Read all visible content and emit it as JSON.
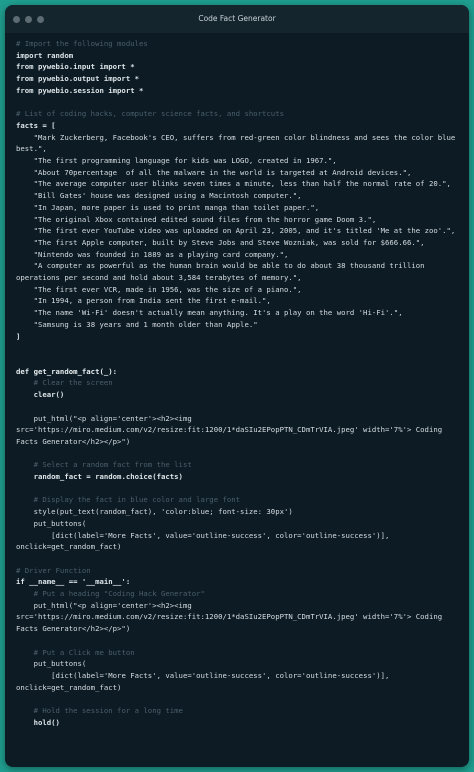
{
  "window": {
    "title": "Code Fact Generator"
  },
  "code": {
    "lines": [
      {
        "cls": "cm",
        "text": "# Import the following modules"
      },
      {
        "cls": "kw",
        "text": "import random"
      },
      {
        "cls": "kw",
        "text": "from pywebio.input import *"
      },
      {
        "cls": "kw",
        "text": "from pywebio.output import *"
      },
      {
        "cls": "kw",
        "text": "from pywebio.session import *"
      },
      {
        "cls": "",
        "text": " "
      },
      {
        "cls": "cm",
        "text": "# List of coding hacks, computer science facts, and shortcuts"
      },
      {
        "cls": "kw",
        "text": "facts = ["
      },
      {
        "cls": "st",
        "text": "    \"Mark Zuckerberg, Facebook's CEO, suffers from red-green color blindness and sees the color blue best.\","
      },
      {
        "cls": "st",
        "text": "    \"The first programming language for kids was LOGO, created in 1967.\","
      },
      {
        "cls": "st",
        "text": "    \"About 70percentage  of all the malware in the world is targeted at Android devices.\","
      },
      {
        "cls": "st",
        "text": "    \"The average computer user blinks seven times a minute, less than half the normal rate of 20.\","
      },
      {
        "cls": "st",
        "text": "    \"Bill Gates' house was designed using a Macintosh computer.\","
      },
      {
        "cls": "st",
        "text": "    \"In Japan, more paper is used to print manga than toilet paper.\","
      },
      {
        "cls": "st",
        "text": "    \"The original Xbox contained edited sound files from the horror game Doom 3.\","
      },
      {
        "cls": "st",
        "text": "    \"The first ever YouTube video was uploaded on April 23, 2005, and it's titled 'Me at the zoo'.\","
      },
      {
        "cls": "st",
        "text": "    \"The first Apple computer, built by Steve Jobs and Steve Wozniak, was sold for $666.66.\","
      },
      {
        "cls": "st",
        "text": "    \"Nintendo was founded in 1889 as a playing card company.\","
      },
      {
        "cls": "st",
        "text": "    \"A computer as powerful as the human brain would be able to do about 38 thousand trillion operations per second and hold about 3,584 terabytes of memory.\","
      },
      {
        "cls": "st",
        "text": "    \"The first ever VCR, made in 1956, was the size of a piano.\","
      },
      {
        "cls": "st",
        "text": "    \"In 1994, a person from India sent the first e-mail.\","
      },
      {
        "cls": "st",
        "text": "    \"The name 'Wi-Fi' doesn't actually mean anything. It's a play on the word 'Hi-Fi'.\","
      },
      {
        "cls": "st",
        "text": "    \"Samsung is 38 years and 1 month older than Apple.\""
      },
      {
        "cls": "kw",
        "text": "]"
      },
      {
        "cls": "",
        "text": " "
      },
      {
        "cls": "",
        "text": " "
      },
      {
        "cls": "fn",
        "text": "def get_random_fact(_):"
      },
      {
        "cls": "cm",
        "text": "    # Clear the screen"
      },
      {
        "cls": "kw",
        "text": "    clear()"
      },
      {
        "cls": "",
        "text": " "
      },
      {
        "cls": "st",
        "text": "    put_html(\"<p align='center'><h2><img src='https://miro.medium.com/v2/resize:fit:1200/1*daSIu2EPopPTN_CDmTrVIA.jpeg' width='7%'> Coding Facts Generator</h2></p>\")"
      },
      {
        "cls": "",
        "text": " "
      },
      {
        "cls": "cm",
        "text": "    # Select a random fact from the list"
      },
      {
        "cls": "kw",
        "text": "    random_fact = random.choice(facts)"
      },
      {
        "cls": "",
        "text": " "
      },
      {
        "cls": "cm",
        "text": "    # Display the fact in blue color and large font"
      },
      {
        "cls": "st",
        "text": "    style(put_text(random_fact), 'color:blue; font-size: 30px')"
      },
      {
        "cls": "st",
        "text": "    put_buttons("
      },
      {
        "cls": "st",
        "text": "        [dict(label='More Facts', value='outline-success', color='outline-success')], onclick=get_random_fact)"
      },
      {
        "cls": "",
        "text": " "
      },
      {
        "cls": "cm",
        "text": "# Driver Function"
      },
      {
        "cls": "kw",
        "text": "if __name__ == '__main__':"
      },
      {
        "cls": "cm",
        "text": "    # Put a heading \"Coding Hack Generator\""
      },
      {
        "cls": "st",
        "text": "    put_html(\"<p align='center'><h2><img src='https://miro.medium.com/v2/resize:fit:1200/1*daSIu2EPopPTN_CDmTrVIA.jpeg' width='7%'> Coding Facts Generator</h2></p>\")"
      },
      {
        "cls": "",
        "text": " "
      },
      {
        "cls": "cm",
        "text": "    # Put a Click me button"
      },
      {
        "cls": "st",
        "text": "    put_buttons("
      },
      {
        "cls": "st",
        "text": "        [dict(label='More Facts', value='outline-success', color='outline-success')], onclick=get_random_fact)"
      },
      {
        "cls": "",
        "text": " "
      },
      {
        "cls": "cm",
        "text": "    # Hold the session for a long time"
      },
      {
        "cls": "kw",
        "text": "    hold()"
      }
    ]
  }
}
